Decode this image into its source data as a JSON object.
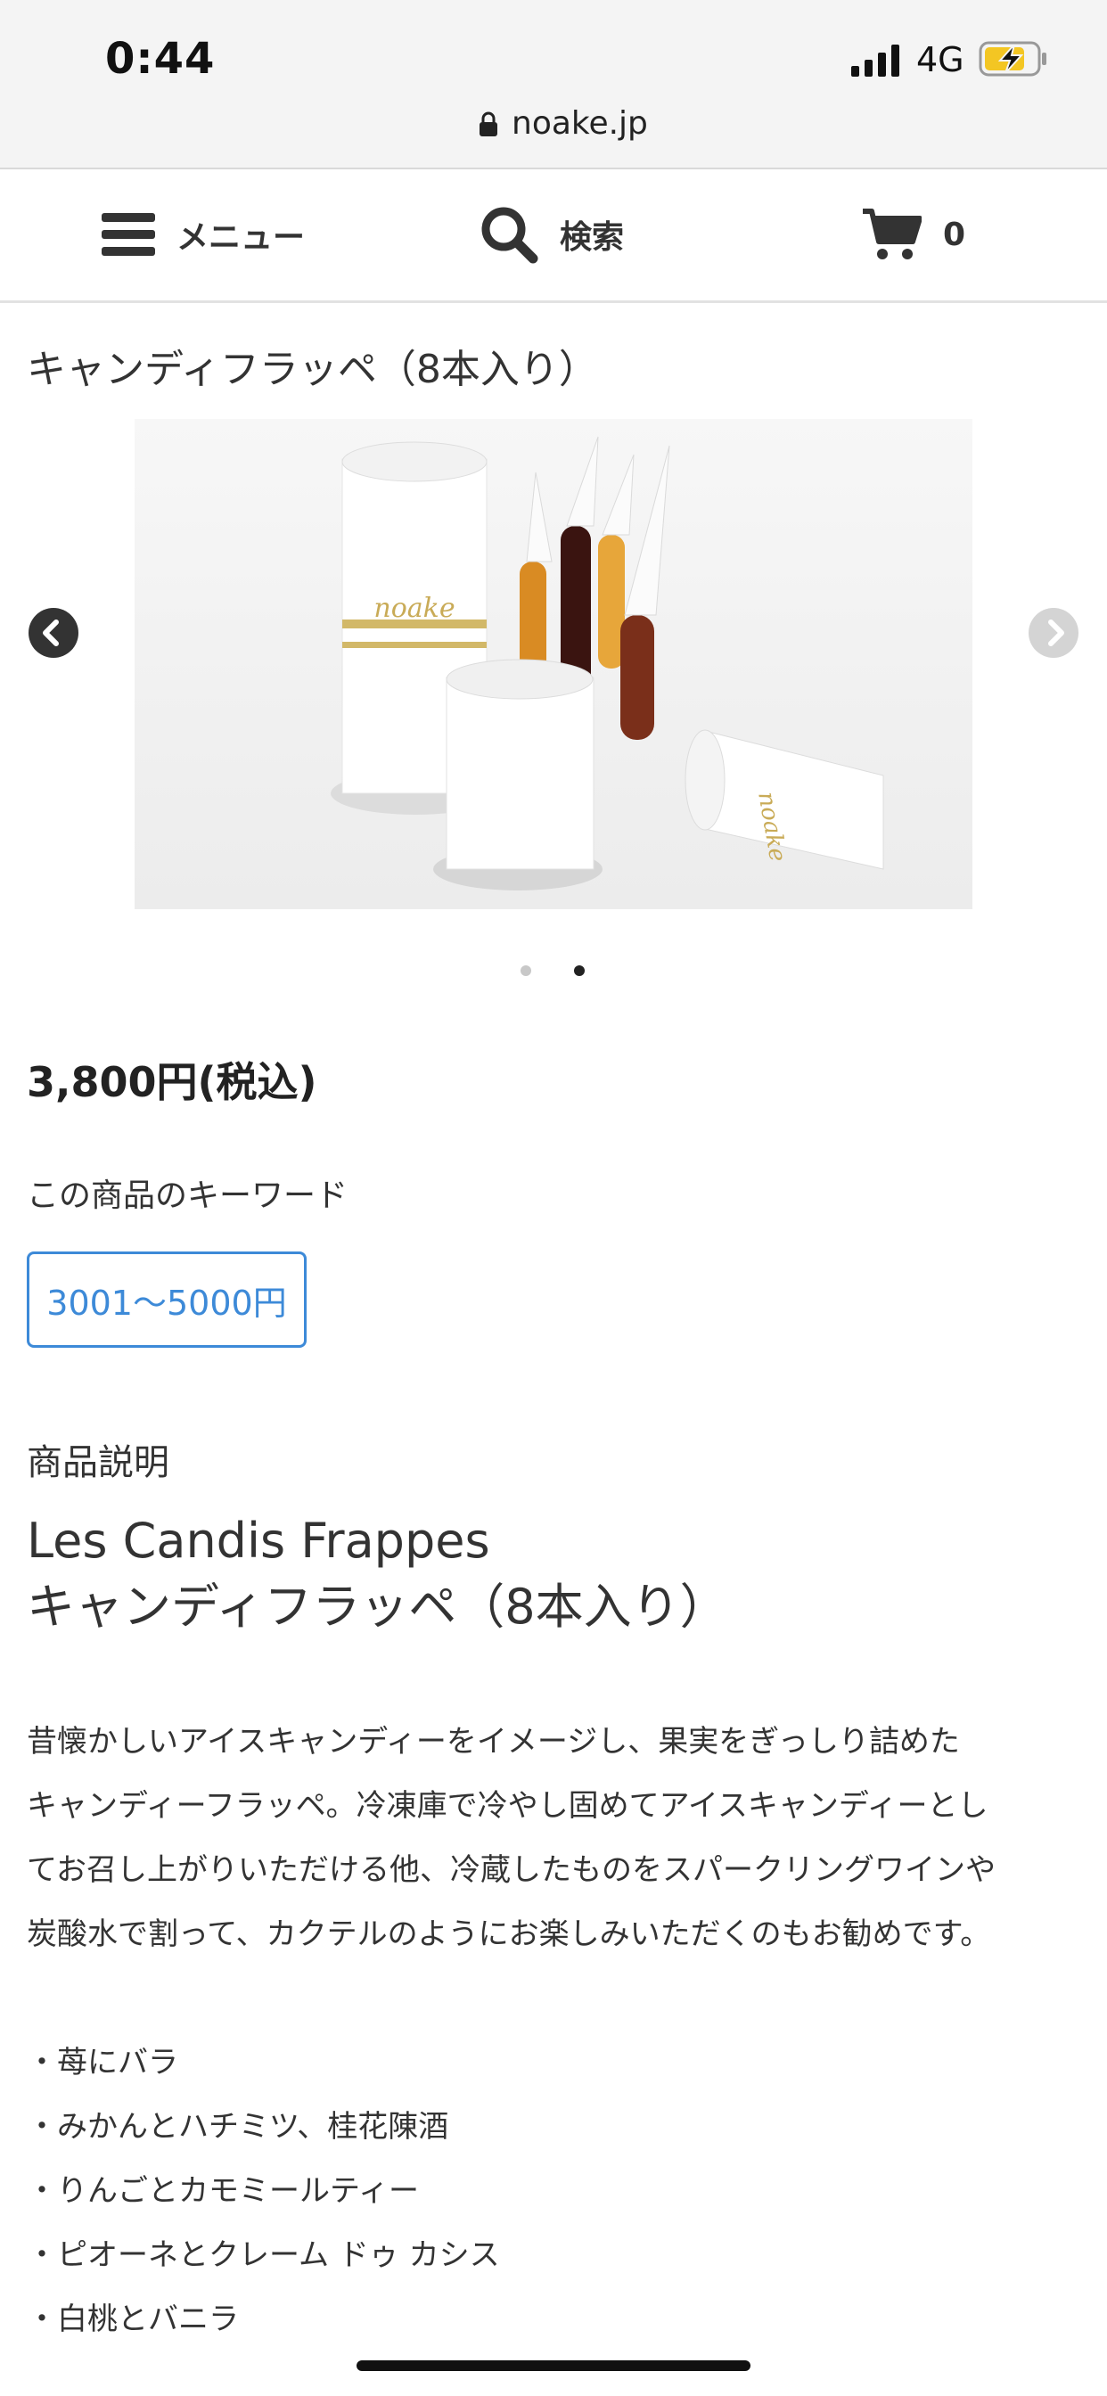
{
  "status_bar": {
    "time": "0:44",
    "network": "4G",
    "battery_color": "#f3c623"
  },
  "browser": {
    "url": "noake.jp"
  },
  "header": {
    "menu_label": "メニュー",
    "search_label": "検索",
    "cart_count": "0"
  },
  "product": {
    "title": "キャンディフラッペ（8本入り）",
    "image_brand_text": "noake",
    "carousel": {
      "slide_count": 2,
      "active_index": 2
    },
    "price": "3,800円(税込)",
    "keywords_heading": "この商品のキーワード",
    "keyword_tag": "3001～5000円",
    "description_heading": "商品説明",
    "description_title_line1": "Les Candis Frappes",
    "description_title_line2": "キャンディフラッペ（8本入り）",
    "description_lines": [
      "昔懐かしいアイスキャンディーをイメージし、果実をぎっしり詰めた",
      "キャンディーフラッペ。冷凍庫で冷やし固めてアイスキャンディーとし",
      "てお召し上がりいただける他、冷蔵したものをスパークリングワインや",
      "炭酸水で割って、カクテルのようにお楽しみいただくのもお勧めです。"
    ],
    "flavors": [
      "・苺にバラ",
      "・みかんとハチミツ、桂花陳酒",
      "・りんごとカモミールティー",
      "・ピオーネとクレーム ドゥ カシス",
      "・白桃とバニラ"
    ]
  },
  "colors": {
    "accent": "#3d8ad8",
    "text": "#333333"
  }
}
